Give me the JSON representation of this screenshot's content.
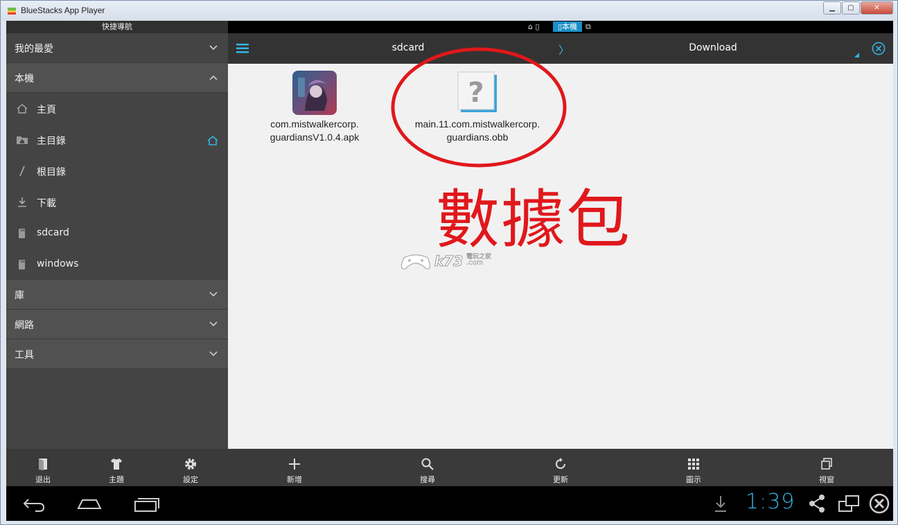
{
  "window": {
    "title": "BlueStacks App Player"
  },
  "sidebar": {
    "header": "快捷導航",
    "groups": [
      {
        "label": "我的最愛",
        "expanded": false
      },
      {
        "label": "本機",
        "expanded": true
      },
      {
        "label": "庫",
        "expanded": false
      },
      {
        "label": "網路",
        "expanded": false
      },
      {
        "label": "工具",
        "expanded": false
      }
    ],
    "local_items": [
      {
        "label": "主頁",
        "icon": "home-icon"
      },
      {
        "label": "主目錄",
        "icon": "folder-home-icon"
      },
      {
        "label": "根目錄",
        "icon": "slash-icon"
      },
      {
        "label": "下載",
        "icon": "download-icon"
      },
      {
        "label": "sdcard",
        "icon": "sdcard-icon"
      },
      {
        "label": "windows",
        "icon": "sdcard-icon"
      }
    ],
    "toolbar": [
      {
        "label": "退出",
        "icon": "exit-icon"
      },
      {
        "label": "主題",
        "icon": "shirt-icon"
      },
      {
        "label": "設定",
        "icon": "gear-icon"
      }
    ]
  },
  "status_bar": {
    "active_label": "本機"
  },
  "breadcrumb": {
    "first": "sdcard",
    "separator": "〉",
    "second": "Download"
  },
  "files": [
    {
      "name_line1": "com.mistwalkercorp.",
      "name_line2": "guardiansV1.0.4.apk",
      "icon": "app-icon"
    },
    {
      "name_line1": "main.11.com.mistwalkercorp.",
      "name_line2": "guardians.obb",
      "icon": "unknown-file-icon"
    }
  ],
  "annotation": {
    "text": "數據包",
    "color": "#e0181c"
  },
  "watermark": {
    "text": "k73",
    "sub": "電玩之家",
    "domain": ".com"
  },
  "bottom_toolbar": [
    {
      "label": "新增",
      "icon": "plus-icon"
    },
    {
      "label": "搜尋",
      "icon": "search-icon"
    },
    {
      "label": "更新",
      "icon": "refresh-icon"
    },
    {
      "label": "圖示",
      "icon": "grid-icon"
    },
    {
      "label": "視窗",
      "icon": "windows-icon"
    }
  ],
  "nav": {
    "clock": "1:39"
  },
  "colors": {
    "accent": "#33b5e5",
    "sidebar_bg": "#444444",
    "content_bg": "#f1f1f1"
  }
}
